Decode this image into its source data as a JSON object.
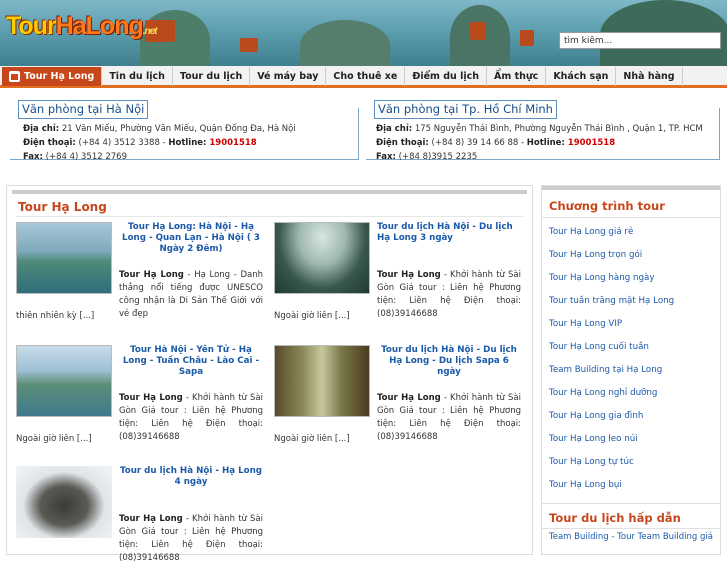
{
  "header": {
    "logo": {
      "part1": "Tour",
      "part2": "HaLong",
      "part3": ".net"
    },
    "search_value": "tìm kiếm..."
  },
  "nav": {
    "items": [
      "Tour Hạ Long",
      "Tin du lịch",
      "Tour du lịch",
      "Vé máy bay",
      "Cho thuê xe",
      "Điểm du lịch",
      "Ẩm thực",
      "Khách sạn",
      "Nhà hàng"
    ]
  },
  "offices": [
    {
      "title": "Văn phòng tại Hà Nội",
      "addr_label": "Địa chỉ:",
      "addr": " 21 Văn Miếu, Phường Văn Miếu, Quận Đống Đa, Hà Nội",
      "phone_label": "Điện thoại:",
      "phone": " (+84 4) 3512 3388 - ",
      "hotline_label": "Hotline:",
      "hotline": " 19001518",
      "fax_label": "Fax:",
      "fax": " (+84 4) 3512 2769"
    },
    {
      "title": "Văn phòng tại Tp. Hồ Chí Minh",
      "addr_label": "Địa chỉ:",
      "addr": " 175 Nguyễn Thái Bình, Phường Nguyễn Thái Bình , Quận 1, TP. HCM",
      "phone_label": "Điện thoại:",
      "phone": " (+84 8) 39 14 66 88 - ",
      "hotline_label": "Hotline:",
      "hotline": " 19001518",
      "fax_label": "Fax:",
      "fax": " (+84 8)3915 2235"
    }
  ],
  "main": {
    "title": "Tour Hạ Long",
    "items": [
      {
        "title": "Tour Hạ Long: Hà Nội - Hạ Long - Quan Lạn - Hà Nội ( 3 Ngày 2 Đêm)",
        "lead": "Tour Hạ Long",
        "desc": " - Hạ Long - Danh thắng nổi tiếng được UNESCO công nhận là Di Sản Thế Giới với vẻ đẹp",
        "desc2": "thiên nhiên kỳ [...]"
      },
      {
        "title": "Tour du lịch Hà Nội - Du lịch Hạ Long 3 ngày",
        "lead": "Tour Hạ Long",
        "desc": " - Khởi hành từ Sài Gòn Giá tour : Liên hệ Phương tiện: Liên hệ Điện thoại: (08)39146688",
        "desc2": "Ngoài giờ liên [...]"
      },
      {
        "title": "Tour Hà Nội - Yên Tử - Hạ Long - Tuần Châu - Lào Cai - Sapa",
        "lead": "Tour Hạ Long",
        "desc": " - Khởi hành từ Sài Gòn Giá tour : Liên hệ Phương tiện: Liên hệ Điện thoại: (08)39146688",
        "desc2": "Ngoài giờ liên [...]"
      },
      {
        "title": "Tour du lịch Hà Nội - Du lịch Hạ Long - Du lịch Sapa 6 ngày",
        "lead": "Tour Hạ Long",
        "desc": " - Khởi hành từ Sài Gòn Giá tour : Liên hệ Phương tiện: Liên hệ Điện thoại: (08)39146688",
        "desc2": "Ngoài giờ liên [...]"
      },
      {
        "title": "Tour du lịch Hà Nội - Hạ Long 4 ngày",
        "lead": "Tour Hạ Long",
        "desc": " - Khởi hành từ Sài Gòn Giá tour : Liên hệ Phương tiện: Liên hệ Điện thoại: (08)39146688",
        "desc2": ""
      }
    ]
  },
  "sidebar": {
    "title": "Chương trình tour",
    "links": [
      "Tour Hạ Long giá rẻ",
      "Tour Hạ Long trọn gói",
      "Tour Hạ Long hàng ngày",
      "Tour tuần trăng mật Hạ Long",
      "Tour Hạ Long VIP",
      "Tour Hạ Long cuối tuần",
      "Team Building tại Hạ Long",
      "Tour Hạ Long nghỉ dưỡng",
      "Tour Hạ Long gia đình",
      "Tour Hạ Long leo núi",
      "Tour Hạ Long tự túc",
      "Tour Hạ Long bụi"
    ],
    "title2": "Tour du lịch hấp dẫn",
    "link2": "Team Building - Tour Team Building giá"
  }
}
